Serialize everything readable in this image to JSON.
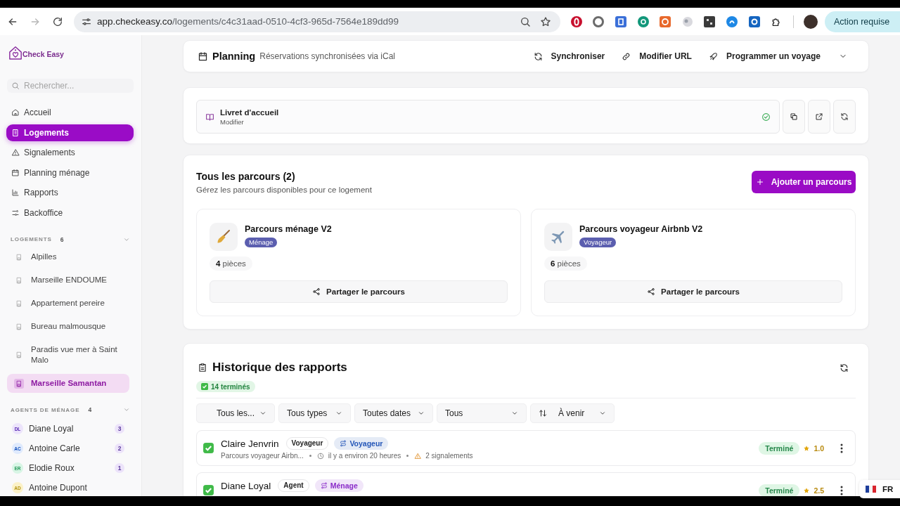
{
  "browser": {
    "url_domain": "app.checkeasy.co",
    "url_path": "/logements/c4c31aad-0510-4cf3-965d-7564e189dd99",
    "forward_disabled": true,
    "action_button": "Action requise"
  },
  "sidebar": {
    "brand": "Check Easy",
    "search": {
      "placeholder": "Rechercher..."
    },
    "nav": [
      {
        "label": "Accueil",
        "selected": false
      },
      {
        "label": "Logements",
        "selected": true
      },
      {
        "label": "Signalements",
        "selected": false
      },
      {
        "label": "Planning ménage",
        "selected": false
      },
      {
        "label": "Rapports",
        "selected": false
      },
      {
        "label": "Backoffice",
        "selected": false
      }
    ],
    "properties": {
      "title": "LOGEMENTS",
      "count": "6",
      "items": [
        {
          "label": "Alpilles",
          "selected": false
        },
        {
          "label": "Marseille ENDOUME",
          "selected": false
        },
        {
          "label": "Appartement pereire",
          "selected": false
        },
        {
          "label": "Bureau malmousque",
          "selected": false
        },
        {
          "label": "Paradis vue mer à Saint Malo",
          "selected": false
        },
        {
          "label": "Marseille Samantan",
          "selected": true
        }
      ]
    },
    "agents": {
      "title": "AGENTS DE MÉNAGE",
      "count": "4",
      "items": [
        {
          "initials": "DL",
          "name": "Diane Loyal",
          "count": "3",
          "color": "#ece4fb"
        },
        {
          "initials": "AC",
          "name": "Antoine Carle",
          "count": "2",
          "color": "#dfeafd"
        },
        {
          "initials": "ER",
          "name": "Elodie Roux",
          "count": "1",
          "color": "#d8f5e5"
        },
        {
          "initials": "AD",
          "name": "Antoine Dupont",
          "color": "#fbf1c7"
        }
      ]
    }
  },
  "planning": {
    "title": "Planning",
    "subtitle": "Réservations synchronisées via iCal",
    "actions": [
      "Synchroniser",
      "Modifier URL",
      "Programmer un voyage"
    ]
  },
  "guidebook": {
    "title": "Livret d'accueil",
    "subtitle": "Modifier",
    "verified": true
  },
  "parcours": {
    "title": "Tous les parcours (2)",
    "subtitle": "Gérez les parcours disponibles pour ce logement",
    "add_button": "Ajouter un parcours",
    "items": [
      {
        "name": "Parcours ménage V2",
        "tag": "Ménage",
        "rooms": "**4** pièces",
        "share_button": "Partager le parcours"
      },
      {
        "name": "Parcours voyageur Airbnb V2",
        "tag": "Voyageur",
        "rooms": "**6** pièces",
        "share_button": "Partager le parcours"
      }
    ]
  },
  "history": {
    "title": "Historique des rapports",
    "completed": "14 terminés",
    "filters": [
      {
        "label": "Tous les...",
        "kind": "select"
      },
      {
        "label": "Tous types",
        "kind": "select"
      },
      {
        "label": "Toutes dates",
        "kind": "select"
      },
      {
        "label": "Tous",
        "kind": "select"
      },
      {
        "label": "À venir",
        "kind": "sort"
      }
    ],
    "reports": [
      {
        "name": "Claire Jenvrin",
        "role": "Voyageur",
        "type": {
          "label": "Voyageur",
          "color": "#2456b8"
        },
        "route": "Parcours voyageur Airbn...",
        "time": "il y a environ 20 heures",
        "issues": "2 signalements",
        "status": "Terminé",
        "rating": "1.0",
        "done": true
      },
      {
        "name": "Diane Loyal",
        "role": "Agent",
        "type": {
          "label": "Ménage",
          "color": "#8a2bc9"
        },
        "status": "Terminé",
        "rating": "2.5",
        "done": true
      }
    ]
  },
  "language": {
    "label": "FR"
  }
}
